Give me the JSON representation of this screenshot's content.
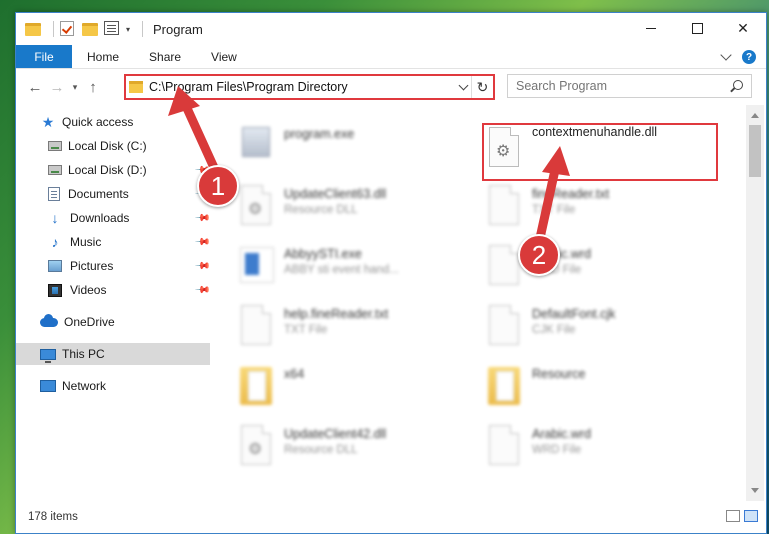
{
  "window": {
    "title": "Program"
  },
  "ribbon": {
    "tabs": [
      "File",
      "Home",
      "Share",
      "View"
    ]
  },
  "address": {
    "path": "C:\\Program Files\\Program Directory"
  },
  "search": {
    "placeholder": "Search Program"
  },
  "sidebar": {
    "items": [
      {
        "label": "Quick access",
        "icon": "star-icon",
        "pinned": false
      },
      {
        "label": "Local Disk (C:)",
        "icon": "drive-icon",
        "pinned": false
      },
      {
        "label": "Local Disk (D:)",
        "icon": "drive-icon",
        "pinned": true
      },
      {
        "label": "Documents",
        "icon": "documents-icon",
        "pinned": true
      },
      {
        "label": "Downloads",
        "icon": "download-icon",
        "pinned": true
      },
      {
        "label": "Music",
        "icon": "music-icon",
        "pinned": true
      },
      {
        "label": "Pictures",
        "icon": "pictures-icon",
        "pinned": true
      },
      {
        "label": "Videos",
        "icon": "video-icon",
        "pinned": true
      },
      {
        "label": "OneDrive",
        "icon": "cloud-icon",
        "pinned": false
      },
      {
        "label": "This PC",
        "icon": "pc-icon",
        "pinned": false,
        "selected": true
      },
      {
        "label": "Network",
        "icon": "network-icon",
        "pinned": false
      }
    ]
  },
  "files": [
    {
      "name": "program.exe",
      "type": "",
      "icon": "exe-icon"
    },
    {
      "name": "contextmenuhandle.dll",
      "type": "",
      "icon": "dll-gear-icon"
    },
    {
      "name": "UpdateClient63.dll",
      "type": "Resource DLL",
      "icon": "dll-gear-icon"
    },
    {
      "name": "fineReader.txt",
      "type": "TXT File",
      "icon": "document-icon"
    },
    {
      "name": "AbbyySTI.exe",
      "type": "ABBY sti event hand...",
      "icon": "app-icon"
    },
    {
      "name": "Arabic.wrd",
      "type": "WRD File",
      "icon": "document-icon"
    },
    {
      "name": "help.fineReader.txt",
      "type": "TXT File",
      "icon": "document-icon"
    },
    {
      "name": "DefaultFont.cjk",
      "type": "CJK File",
      "icon": "document-icon"
    },
    {
      "name": "x64",
      "type": "",
      "icon": "folder-icon"
    },
    {
      "name": "Resource",
      "type": "",
      "icon": "folder-icon"
    },
    {
      "name": "UpdateClient42.dll",
      "type": "Resource DLL",
      "icon": "dll-gear-icon"
    },
    {
      "name": "Arabic.wrd",
      "type": "WRD File",
      "icon": "document-icon"
    }
  ],
  "status": {
    "item_count": "178 items"
  },
  "annotations": {
    "marker1": "1",
    "marker2": "2"
  },
  "colors": {
    "accent": "#1979ca",
    "highlight": "#e0393e",
    "marker": "#d93a3a"
  }
}
